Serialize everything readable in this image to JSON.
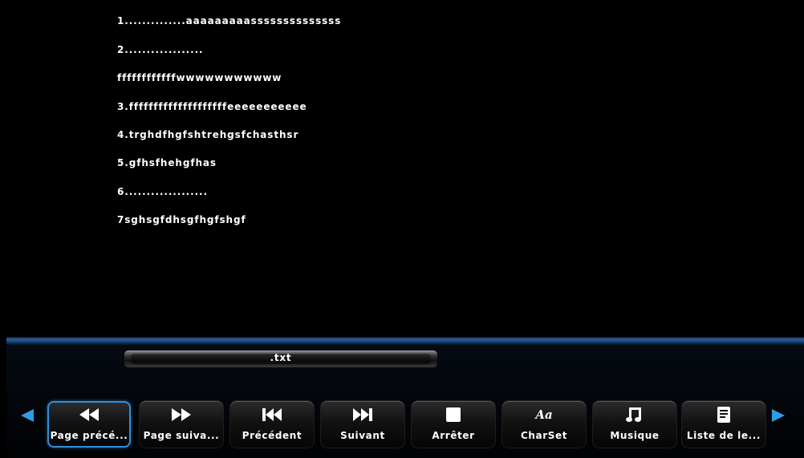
{
  "document": {
    "lines": [
      "1..............aaaaaaaaassssssssssssss",
      "2..................",
      "ffffffffffffwwwwwwwwwww",
      "3.ffffffffffffffffffffeeeeeeeeeee",
      "4.trghdfhgfshtrehgsfchasthsr",
      "5.gfhsfhehgfhas",
      "6...................",
      "7sghsgfdhsgfhgfshgf"
    ]
  },
  "file": {
    "name": ".txt"
  },
  "toolbar": {
    "selected_index": 0,
    "buttons": [
      {
        "label": "Page précé...",
        "icon": "rewind-icon"
      },
      {
        "label": "Page suiva...",
        "icon": "fast-forward-icon"
      },
      {
        "label": "Précédent",
        "icon": "skip-previous-icon"
      },
      {
        "label": "Suivant",
        "icon": "skip-next-icon"
      },
      {
        "label": "Arrêter",
        "icon": "stop-icon"
      },
      {
        "label": "CharSet",
        "icon": "charset-icon",
        "icon_text": "Aa"
      },
      {
        "label": "Musique",
        "icon": "music-note-icon"
      },
      {
        "label": "Liste de le...",
        "icon": "document-list-icon"
      }
    ],
    "scroll_left_icon": "left-arrow-icon",
    "scroll_right_icon": "right-arrow-icon"
  },
  "colors": {
    "background": "#000000",
    "text": "#ffffff",
    "accent": "#2f9de3",
    "selection_border": "#2f8fdc"
  }
}
